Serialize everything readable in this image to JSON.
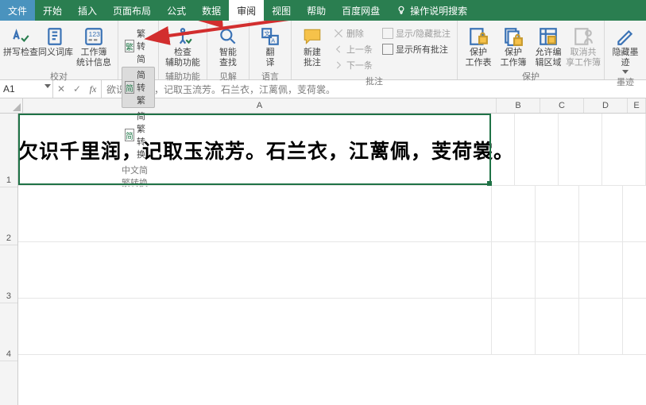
{
  "menu": {
    "file": "文件",
    "items": [
      "开始",
      "插入",
      "页面布局",
      "公式",
      "数据",
      "审阅",
      "视图",
      "帮助",
      "百度网盘"
    ],
    "active_index": 5,
    "search_label": "操作说明搜索"
  },
  "ribbon": {
    "groups": [
      {
        "name": "校对",
        "buttons": [
          {
            "type": "large",
            "label": "拼写检查",
            "icon": "spellcheck"
          },
          {
            "type": "large",
            "label": "同义词库",
            "icon": "thesaurus"
          },
          {
            "type": "large",
            "label": "工作簿\n统计信息",
            "icon": "stats"
          }
        ]
      },
      {
        "name": "中文简繁转换",
        "buttons": [
          {
            "type": "small",
            "label": "繁转简",
            "prefix": "繁"
          },
          {
            "type": "small",
            "label": "简转繁",
            "prefix": "简",
            "highlight": true
          },
          {
            "type": "small",
            "label": "简繁转换",
            "prefix": "简"
          }
        ]
      },
      {
        "name": "辅助功能",
        "buttons": [
          {
            "type": "large",
            "label": "检查\n辅助功能",
            "icon": "accessibility",
            "dropdown": true
          }
        ]
      },
      {
        "name": "见解",
        "buttons": [
          {
            "type": "large",
            "label": "智能\n查找",
            "icon": "smartlookup"
          }
        ]
      },
      {
        "name": "语言",
        "buttons": [
          {
            "type": "large",
            "label": "翻\n译",
            "icon": "translate"
          }
        ]
      },
      {
        "name": "批注",
        "buttons": [
          {
            "type": "large",
            "label": "新建\n批注",
            "icon": "newcomment"
          },
          {
            "type": "inline",
            "items": [
              "删除",
              "上一条",
              "下一条"
            ]
          },
          {
            "type": "check",
            "items": [
              {
                "label": "显示/隐藏批注",
                "disabled": true
              },
              {
                "label": "显示所有批注",
                "disabled": false
              }
            ]
          }
        ]
      },
      {
        "name": "保护",
        "buttons": [
          {
            "type": "large",
            "label": "保护\n工作表",
            "icon": "protect-sheet"
          },
          {
            "type": "large",
            "label": "保护\n工作簿",
            "icon": "protect-book"
          },
          {
            "type": "large",
            "label": "允许编\n辑区域",
            "icon": "allow-edit"
          },
          {
            "type": "large",
            "label": "取消共\n享工作簿",
            "icon": "unshare",
            "disabled": true
          }
        ]
      },
      {
        "name": "墨迹",
        "buttons": [
          {
            "type": "large",
            "label": "隐藏墨\n迹",
            "icon": "ink",
            "dropdown": true
          }
        ]
      }
    ]
  },
  "namebox": "A1",
  "formula": "欲识千里润，记取玉流芳。石兰衣，江蓠佩，芰荷裳。",
  "columns": [
    "A",
    "B",
    "C",
    "D",
    "E"
  ],
  "rows": [
    "1",
    "2",
    "3",
    "4"
  ],
  "cell_a1_text": "欠识千里润，记取玉流芳。石兰衣，江蓠佩，芰荷裳。",
  "colors": {
    "brand": "#2a7e50",
    "file": "#4a93be",
    "arrow": "#d22e2e"
  }
}
